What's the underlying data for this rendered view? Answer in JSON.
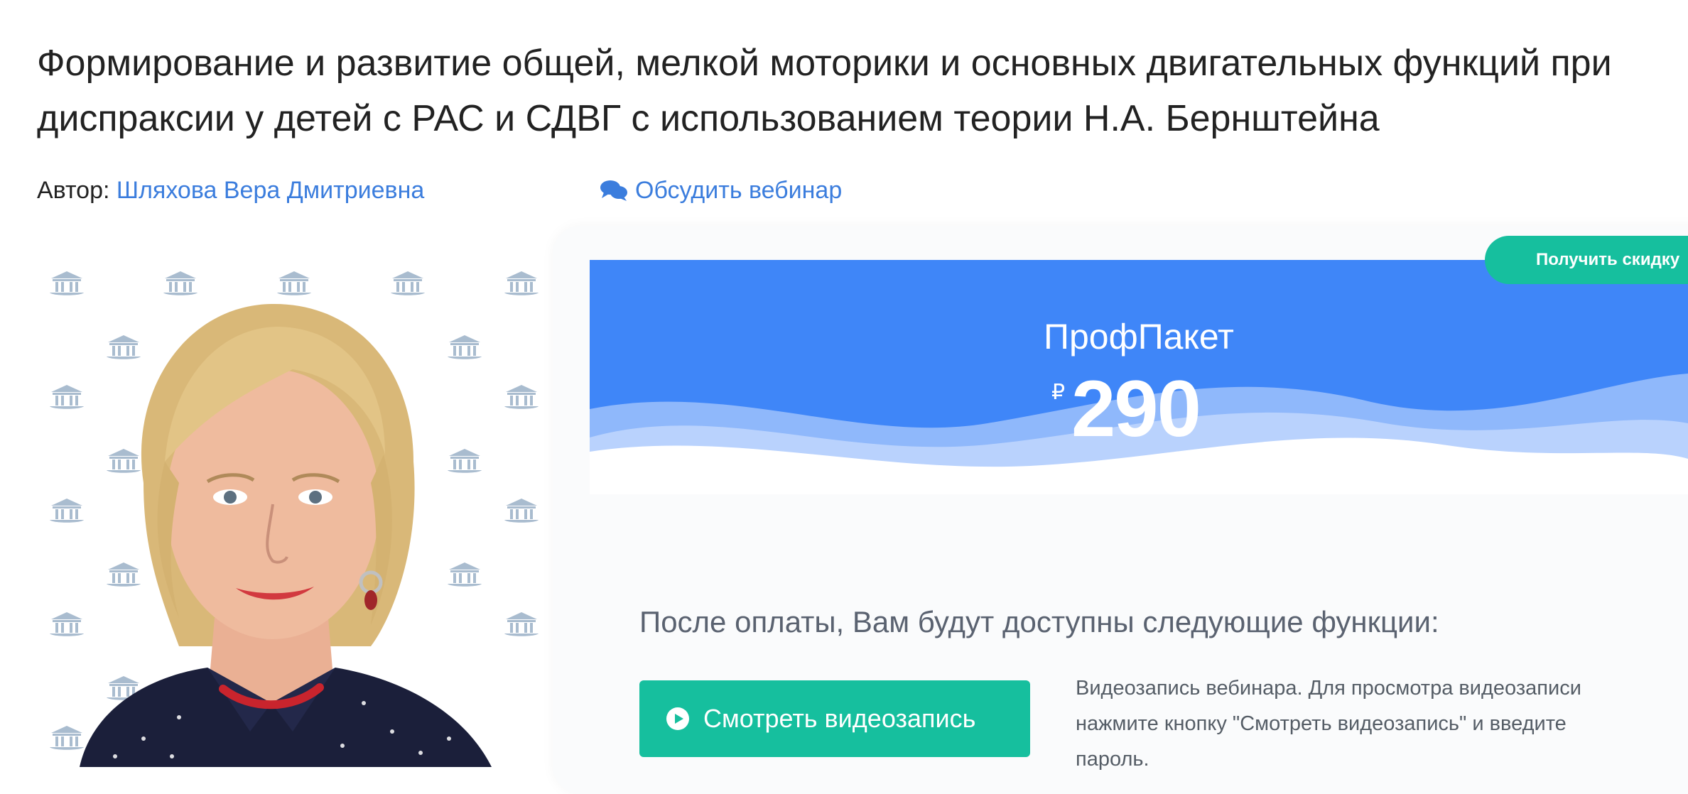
{
  "webinar": {
    "title": "Формирование и развитие общей, мелкой моторики и основных двигательных функций при диспраксии у детей с РАС и СДВГ с использованием теории Н.А. Бернштейна",
    "author_label": "Автор: ",
    "author_name": "Шляхова Вера Дмитриевна",
    "discuss_label": "Обсудить вебинар"
  },
  "pricing": {
    "package_name": "ПрофПакет",
    "currency": "₽",
    "price": "290",
    "discount_label": "Получить скидку",
    "features_title": "После оплаты, Вам будут доступны следующие функции:",
    "watch_button_label": "Смотреть видеозапись",
    "watch_description": "Видеозапись вебинара. Для просмотра видеозаписи нажмите кнопку \"Смотреть видеозапись\" и введите пароль."
  },
  "colors": {
    "link": "#3b7ddd",
    "header_blue": "#3f86f8",
    "accent_green": "#16bf9e"
  },
  "icons": {
    "discuss": "comments-icon",
    "play": "play-circle-icon",
    "pattern": "institution-icon"
  }
}
